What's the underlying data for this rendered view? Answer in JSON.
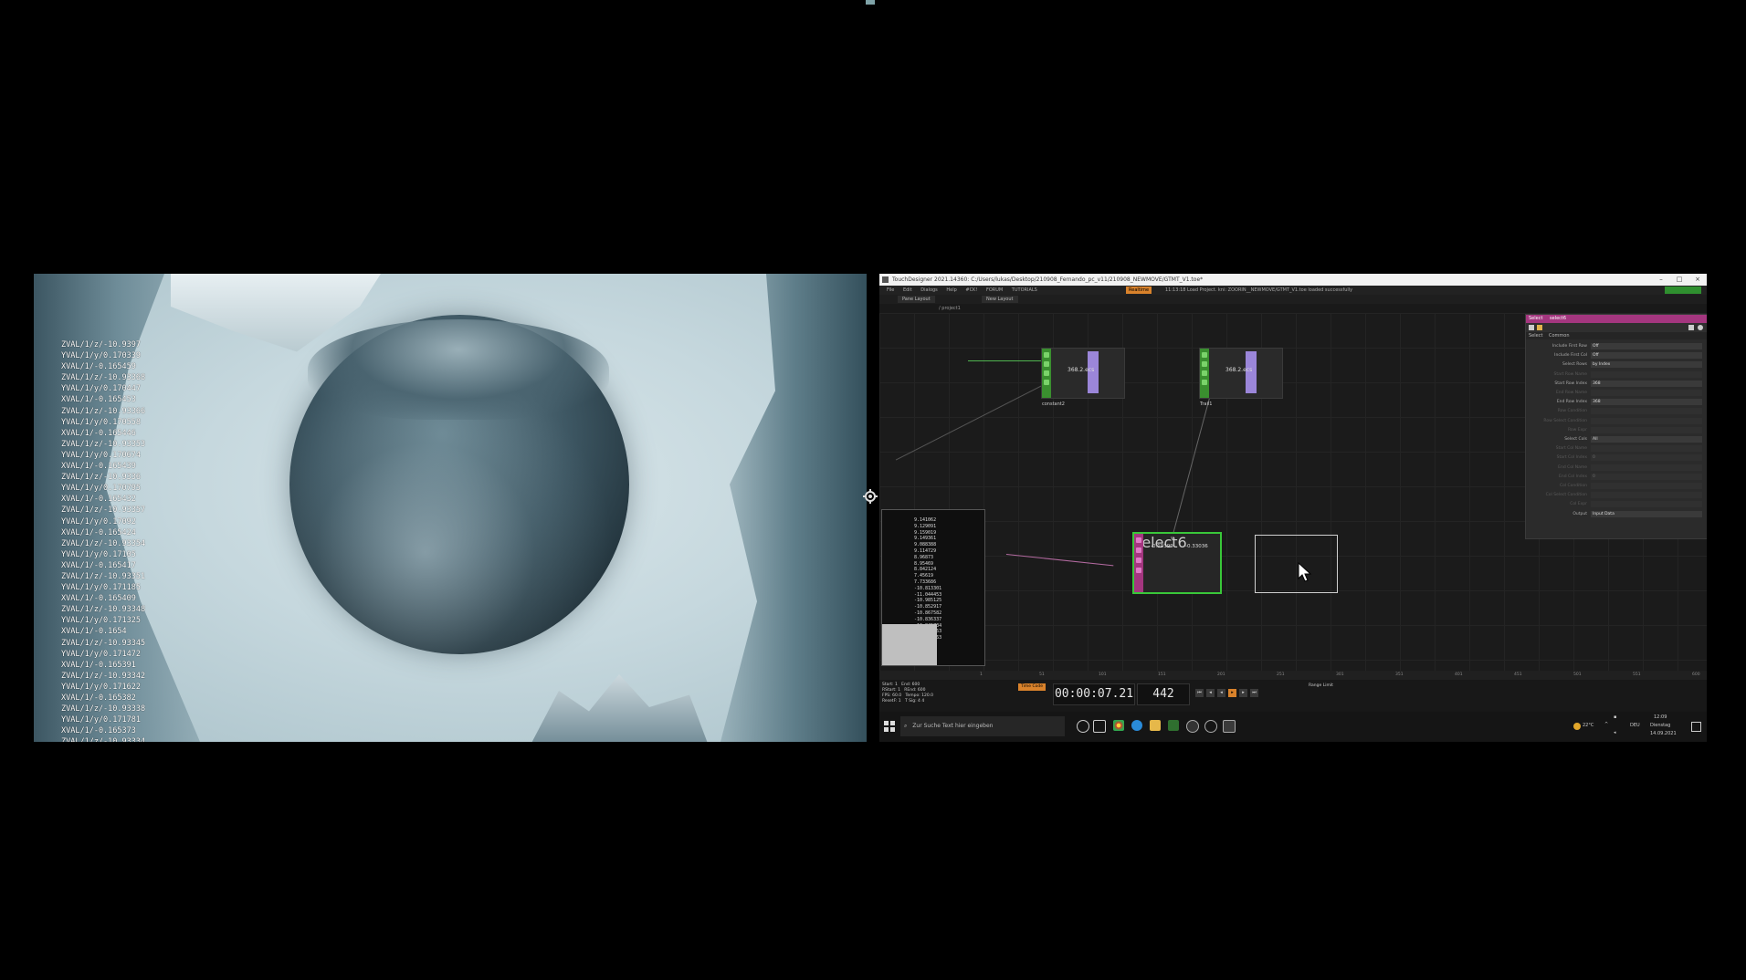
{
  "left_view": {
    "data_lines": [
      "ZVAL/1/z/-10.9397",
      "YVAL/1/y/0.170339",
      "XVAL/1/-0.165459",
      "ZVAL/1/z/-10.93368",
      "YVAL/1/y/0.170447",
      "XVAL/1/-0.165453",
      "ZVAL/1/z/-10.93366",
      "YVAL/1/y/0.170558",
      "XVAL/1/-0.165446",
      "ZVAL/1/z/-10.93353",
      "YVAL/1/y/0.170674",
      "XVAL/1/-0.165439",
      "ZVAL/1/z/-10.9336",
      "YVAL/1/y/0.170795",
      "XVAL/1/-0.165432",
      "ZVAL/1/z/-10.93357",
      "YVAL/1/y/0.17092",
      "XVAL/1/-0.165424",
      "ZVAL/1/z/-10.93354",
      "YVAL/1/y/0.17105",
      "XVAL/1/-0.165417",
      "ZVAL/1/z/-10.93351",
      "YVAL/1/y/0.171185",
      "XVAL/1/-0.165409",
      "ZVAL/1/z/-10.93348",
      "YVAL/1/y/0.171325",
      "XVAL/1/-0.1654",
      "ZVAL/1/z/-10.93345",
      "YVAL/1/y/0.171472",
      "XVAL/1/-0.165391",
      "ZVAL/1/z/-10.93342",
      "YVAL/1/y/0.171622",
      "XVAL/1/-0.165382",
      "ZVAL/1/z/-10.93338",
      "YVAL/1/y/0.171781",
      "XVAL/1/-0.165373",
      "ZVAL/1/z/-10.93334"
    ]
  },
  "td": {
    "title": "TouchDesigner 2021.14360: C:/Users/lukas/Desktop/210908_Fernando_pc_v11/210908_NEWMOVE/GTMT_V1.toe*",
    "win_buttons": [
      "–",
      "□",
      "×"
    ],
    "menu": [
      "File",
      "Edit",
      "Dialogs",
      "Help",
      "#CK!",
      "",
      "FORUM",
      "TUTORIALS"
    ],
    "realtime": "Realtime",
    "status_text": "11:13:18 Load Project. kni: ZOORIN__NEWMOVE/GTMT_V1.toe loaded successfully",
    "tabs": [
      "Pane Layout",
      "New Layout"
    ],
    "path": "/ project1",
    "nodes": {
      "constant": {
        "label": "constant2",
        "value": "368.2.ecs"
      },
      "trail": {
        "label": "Trail1",
        "value": "368.2.ecs"
      },
      "select": {
        "label": "select6",
        "value_top": "v",
        "value_a": "-0.19399",
        "value_b": "-0.33036"
      }
    },
    "table_rows": [
      "9.141062",
      "9.129091",
      "9.159019",
      "9.149361",
      "9.088388",
      "9.114729",
      "8.96873",
      "8.95469",
      "8.842124",
      "7.45619",
      "7.733686",
      "-10.813301",
      "-11.044453",
      "-10.985125",
      "-10.852917",
      "-10.867582",
      "-10.836337",
      "-10.845734",
      "-10.873353",
      "-10.891363",
      "11.06",
      "-10.69"
    ],
    "params": {
      "header_op": "Select",
      "header_name": "select6",
      "tabs": [
        "Select",
        "Common"
      ],
      "rows": [
        {
          "label": "Include First Row",
          "value": "Off",
          "dim": false
        },
        {
          "label": "Include First Col",
          "value": "Off",
          "dim": false
        },
        {
          "label": "Select Rows",
          "value": "by Index",
          "dim": false
        },
        {
          "label": "Start Row Name",
          "value": "",
          "dim": true
        },
        {
          "label": "Start Row Index",
          "value": "368",
          "dim": false
        },
        {
          "label": "End Row Name",
          "value": "",
          "dim": true
        },
        {
          "label": "End Row Index",
          "value": "368",
          "dim": false
        },
        {
          "label": "Row Condition",
          "value": "",
          "dim": true
        },
        {
          "label": "Row Select Condition",
          "value": "",
          "dim": true
        },
        {
          "label": "Row Expr",
          "value": "",
          "dim": true
        },
        {
          "label": "Select Cols",
          "value": "All",
          "dim": false
        },
        {
          "label": "Start Col Name",
          "value": "",
          "dim": true
        },
        {
          "label": "Start Col Index",
          "value": "0",
          "dim": true
        },
        {
          "label": "End Col Name",
          "value": "",
          "dim": true
        },
        {
          "label": "End Col Index",
          "value": "0",
          "dim": true
        },
        {
          "label": "Col Condition",
          "value": "",
          "dim": true
        },
        {
          "label": "Col Select Condition",
          "value": "",
          "dim": true
        },
        {
          "label": "Col Expr",
          "value": "",
          "dim": true
        },
        {
          "label": "Output",
          "value": "Input Data",
          "dim": false
        }
      ]
    },
    "info": {
      "start": "Start:",
      "start_v": "1",
      "end": "End:",
      "end_v": "600",
      "rstart": "RStart:",
      "rstart_v": "1",
      "rend": "REnd:",
      "rend_v": "600",
      "fps": "FPS:",
      "fps_v": "60.0",
      "tempo": "Tempo:",
      "tempo_v": "120.0",
      "reset": "ResetF:",
      "reset_v": "1",
      "tsig": "T Sig:",
      "tsig_v": "4  4"
    },
    "timecode": "00:00:07.21",
    "frame": "442",
    "realtime_btn": "Time Code",
    "range": "Range Limit",
    "timeline_ticks": [
      "1",
      "51",
      "101",
      "151",
      "201",
      "251",
      "301",
      "351",
      "401",
      "451",
      "501",
      "551",
      "600"
    ]
  },
  "taskbar": {
    "search_placeholder": "Zur Suche Text hier eingeben",
    "temp": "22°C",
    "lang": "DEU",
    "time": "12:09",
    "day": "Dienstag",
    "date": "14.09.2021"
  },
  "colors": {
    "node_green": "#3a8f2f",
    "select_purple": "#a4367f",
    "selected_border": "#39c739",
    "realtime_orange": "#d9822b"
  }
}
